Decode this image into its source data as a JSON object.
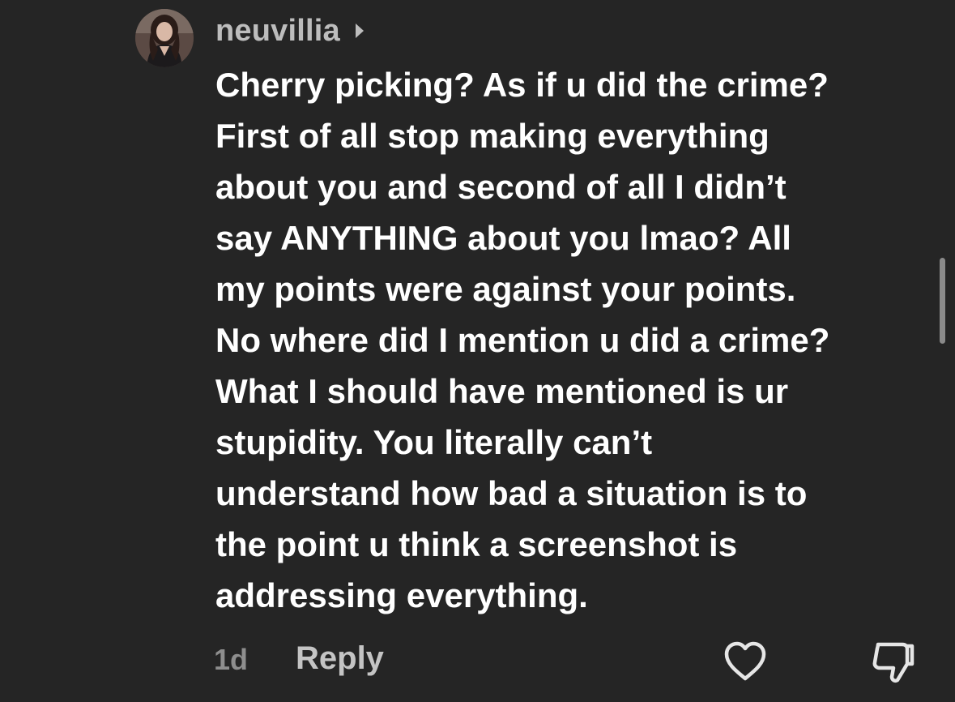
{
  "comment": {
    "avatar_icon": "user-avatar-photo",
    "username": "neuvillia",
    "username_chevron_icon": "chevron-right-icon",
    "lines": [
      "Cherry picking? As if u did the crime?",
      "First of all stop making everything",
      "about you and second of all I didn’t",
      "say ANYTHING about you lmao? All",
      "my points were against your points.",
      "No where did I mention u did a crime?",
      "What I should have mentioned is ur",
      "stupidity. You literally can’t",
      "understand how bad a situation is to",
      "the point u think a screenshot is",
      "addressing everything."
    ],
    "timestamp": "1d",
    "reply_label": "Reply",
    "like_icon": "heart-outline-icon",
    "dislike_icon": "thumbs-down-icon"
  },
  "colors": {
    "background": "#252525",
    "username": "#bdbdbd",
    "text": "#ffffff",
    "muted": "#8e8e8e"
  }
}
